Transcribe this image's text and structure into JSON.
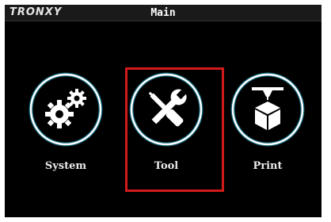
{
  "header": {
    "brand": "TRONXY",
    "title": "Main"
  },
  "menu": {
    "items": [
      {
        "label": "System",
        "icon": "gears-icon",
        "selected": false
      },
      {
        "label": "Tool",
        "icon": "wrench-screwdriver-icon",
        "selected": true
      },
      {
        "label": "Print",
        "icon": "printer-nozzle-cube-icon",
        "selected": false
      }
    ]
  },
  "colors": {
    "background": "#000000",
    "icon_ring": "#ffffff",
    "icon_glow": "#1aa7c9",
    "selection": "#d11a1a"
  }
}
